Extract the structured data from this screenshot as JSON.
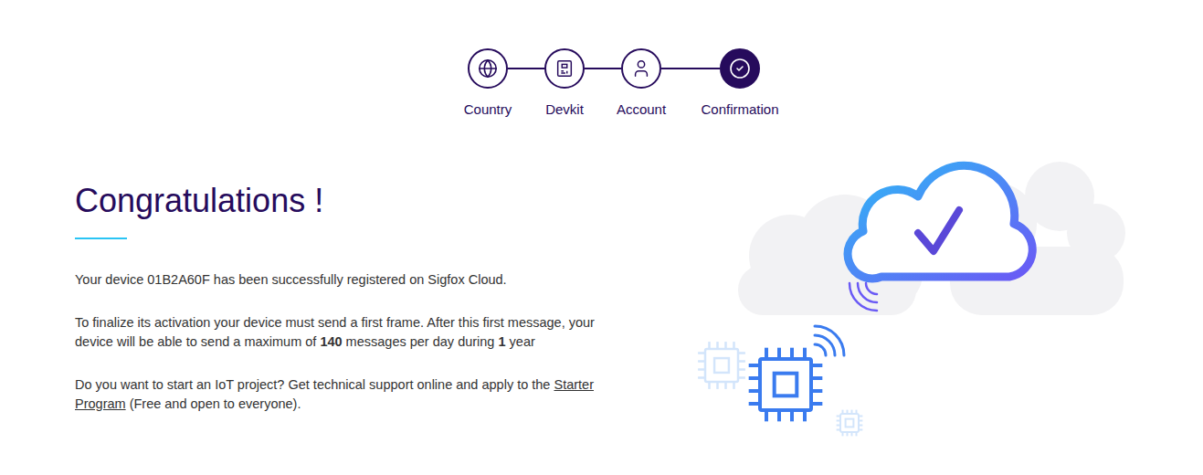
{
  "stepper": {
    "steps": [
      {
        "label": "Country",
        "selected": false
      },
      {
        "label": "Devkit",
        "selected": false
      },
      {
        "label": "Account",
        "selected": false
      },
      {
        "label": "Confirmation",
        "selected": true
      }
    ]
  },
  "heading": "Congratulations !",
  "paragraphs": [
    {
      "parts": [
        {
          "kind": "plain",
          "text": "Your device 01B2A60F has been successfully registered on Sigfox Cloud."
        }
      ]
    },
    {
      "parts": [
        {
          "kind": "plain",
          "text": "To finalize its activation your device must send a first frame. After this first message, your device will be able to send a maximum of "
        },
        {
          "kind": "bold",
          "text": "140"
        },
        {
          "kind": "plain",
          "text": " messages per day during "
        },
        {
          "kind": "bold",
          "text": "1"
        },
        {
          "kind": "plain",
          "text": " year"
        }
      ]
    },
    {
      "parts": [
        {
          "kind": "plain",
          "text": "Do you want to start an IoT project? Get technical support online and apply to the "
        },
        {
          "kind": "link",
          "text": "Starter Program"
        },
        {
          "kind": "plain",
          "text": " (Free and open to everyone)."
        }
      ]
    }
  ]
}
